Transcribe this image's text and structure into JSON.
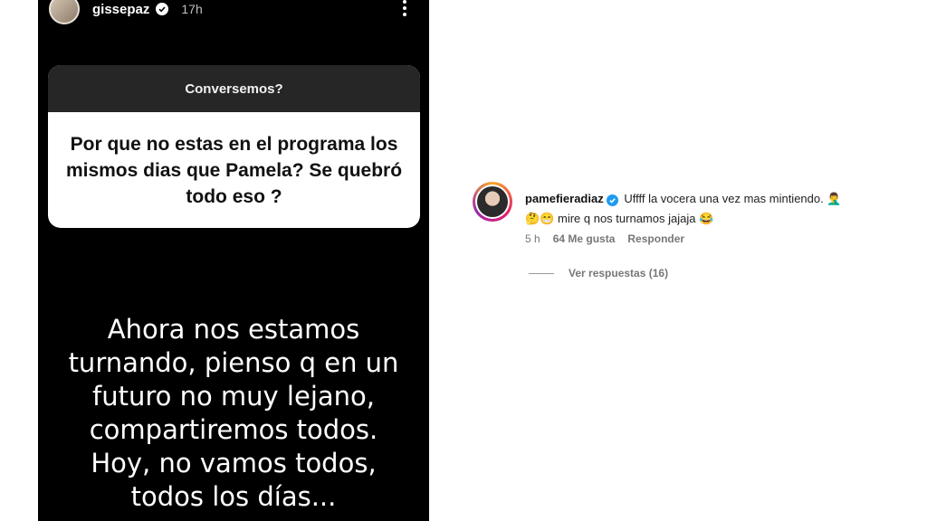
{
  "story": {
    "username": "gissepaz",
    "time": "17h",
    "question_title": "Conversemos?",
    "question_text": "Por que no estas en el programa los\nmismos dias que Pamela? Se quebró\ntodo eso ?",
    "answer_text": "Ahora nos estamos\nturnando, pienso q en un\nfuturo no muy lejano,\ncompartiremos todos.\nHoy, no vamos todos,\ntodos los días..."
  },
  "comment": {
    "username": "pamefieradiaz",
    "text_line1": "Uffff la vocera una vez mas mintiendo. 🤦‍♂️",
    "text_line2": "🤔😁 mire q nos turnamos jajaja 😂",
    "time": "5 h",
    "likes": "64 Me gusta",
    "reply_label": "Responder",
    "view_replies": "Ver respuestas (16)"
  },
  "icons": {
    "verified": "verified-badge-icon",
    "more": "more-options-icon"
  },
  "colors": {
    "story_bg": "#000000",
    "question_header_bg": "#262626",
    "verified_blue": "#1d9bf0"
  }
}
